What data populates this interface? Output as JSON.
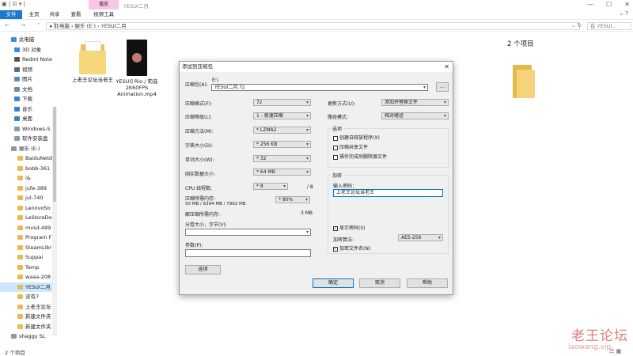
{
  "explorer": {
    "title": "YESUI二月",
    "quick_access": "▣ | ☑ ▾ |",
    "context_tab": "播放",
    "window_buttons": [
      "—",
      "☐",
      "✕"
    ],
    "ribbon_tabs": [
      "文件",
      "主页",
      "共享",
      "查看",
      "视频工具"
    ],
    "ribbon_right": "⌄ ?",
    "nav_buttons": "← → ⌃ ↑",
    "breadcrumb": "▸ 此电脑 › 娱乐 (E:) › YESUI二月",
    "breadcrumb_dropdown": "⌄ ↻",
    "search_placeholder": "在 YESUI...",
    "sidebar": [
      {
        "label": "此电脑",
        "icon": "computer-icon",
        "color": "#3a8fd8"
      },
      {
        "label": "3D 对象",
        "icon": "cube-icon",
        "color": "#3a8fd8"
      },
      {
        "label": "Redmi Note",
        "icon": "phone-icon",
        "color": "#555555"
      },
      {
        "label": "视频",
        "icon": "video-folder-icon",
        "color": "#5b6b7c"
      },
      {
        "label": "图片",
        "icon": "picture-folder-icon",
        "color": "#5b8bbd"
      },
      {
        "label": "文档",
        "icon": "document-folder-icon",
        "color": "#7a8896"
      },
      {
        "label": "下载",
        "icon": "download-folder-icon",
        "color": "#2f86d6"
      },
      {
        "label": "音乐",
        "icon": "music-folder-icon",
        "color": "#3b7fc8"
      },
      {
        "label": "桌面",
        "icon": "desktop-folder-icon",
        "color": "#3d82c7"
      },
      {
        "label": "Windows-S",
        "icon": "drive-icon",
        "color": "#8a9aa8"
      },
      {
        "label": "软件安装盘",
        "icon": "drive-icon",
        "color": "#8a9aa8"
      },
      {
        "label": "娱乐 (E:)",
        "icon": "drive-icon",
        "color": "#8a9aa8"
      },
      {
        "label": "BaiduNetd",
        "icon": "folder-icon",
        "color": "#e6bc4e"
      },
      {
        "label": "bobb-361",
        "icon": "folder-icon",
        "color": "#e6bc4e"
      },
      {
        "label": "i&",
        "icon": "folder-icon",
        "color": "#e6bc4e"
      },
      {
        "label": "jufe-389",
        "icon": "folder-icon",
        "color": "#e6bc4e"
      },
      {
        "label": "jul-740",
        "icon": "folder-icon",
        "color": "#e6bc4e"
      },
      {
        "label": "LenovoSo",
        "icon": "folder-icon",
        "color": "#e6bc4e"
      },
      {
        "label": "LeStoreDo",
        "icon": "folder-icon",
        "color": "#e6bc4e"
      },
      {
        "label": "mvsd-499",
        "icon": "folder-icon",
        "color": "#e6bc4e"
      },
      {
        "label": "Program F",
        "icon": "folder-icon",
        "color": "#e6bc4e"
      },
      {
        "label": "SteamLibr",
        "icon": "folder-icon",
        "color": "#e6bc4e"
      },
      {
        "label": "Suppai",
        "icon": "folder-icon",
        "color": "#e6bc4e"
      },
      {
        "label": "Temp",
        "icon": "folder-icon",
        "color": "#e6bc4e"
      },
      {
        "label": "waaa-208",
        "icon": "folder-icon",
        "color": "#e6bc4e"
      },
      {
        "label": "YESUI二月",
        "icon": "folder-icon",
        "color": "#e6bc4e",
        "selected": true
      },
      {
        "label": "没有7",
        "icon": "folder-icon",
        "color": "#e6bc4e"
      },
      {
        "label": "上老王论坛",
        "icon": "folder-icon",
        "color": "#e6bc4e"
      },
      {
        "label": "新建文件夹",
        "icon": "folder-icon",
        "color": "#e6bc4e"
      },
      {
        "label": "新建文件夹",
        "icon": "folder-icon",
        "color": "#e6bc4e"
      },
      {
        "label": "shaggy SL",
        "icon": "drive-icon",
        "color": "#8a9aa8"
      }
    ],
    "files": [
      {
        "name": "上老王论坛当老王",
        "type": "folder"
      },
      {
        "name": "YESUI] Rio / 莉音 2K60FPS Animation.mp4",
        "type": "video"
      }
    ],
    "item_count_right": "2 个项目",
    "status": "2 个项目",
    "view_buttons": "☷ ▦",
    "watermark": "老王论坛",
    "watermark_sub": "laowang.vip"
  },
  "dialog": {
    "title": "添加到压缩包",
    "close": "✕",
    "archive_label": "压缩包(A):",
    "archive_path": "E:\\",
    "archive_value": "YESUI二月.7z",
    "browse_button": "...",
    "left_fields": [
      {
        "label": "压缩格式(F):",
        "value": "7z"
      },
      {
        "label": "压缩等级(L):",
        "value": "1 - 极速压缩"
      },
      {
        "label": "压缩方法(M):",
        "value": "* LZMA2"
      },
      {
        "label": "字典大小(D):",
        "value": "* 256 KB"
      },
      {
        "label": "单词大小(W):",
        "value": "* 32"
      },
      {
        "label": "固实数据大小:",
        "value": "* 64 MB"
      }
    ],
    "cpu_label": "CPU 线程数:",
    "cpu_value": "* 8",
    "cpu_max": "/ 8",
    "mem_label": "压缩所需内存:",
    "mem_detail": "50 MB / 6394 MB / 7992 MB",
    "mem_value": "* 80%",
    "decomp_label": "解压缩所需内存:",
    "decomp_value": "3 MB",
    "split_label": "分卷大小，字节(V):",
    "params_label": "参数(P):",
    "options_button": "选项",
    "update_label": "更新方式(U):",
    "update_value": "添加并替换文件",
    "pathmode_label": "路径模式:",
    "pathmode_value": "相对路径",
    "options_group": "选项",
    "options": [
      {
        "label": "创建自释放程序(X)",
        "checked": false
      },
      {
        "label": "压缩共享文件",
        "checked": false
      },
      {
        "label": "操作完成后删除源文件",
        "checked": false
      }
    ],
    "encrypt_group": "加密",
    "password_label": "输入密码：",
    "password_value": "上老王论坛当老王",
    "show_password": {
      "label": "显示密码(S)",
      "checked": true
    },
    "encrypt_method_label": "加密算法:",
    "encrypt_method_value": "AES-256",
    "encrypt_names": {
      "label": "加密文件名(N)",
      "checked": true
    },
    "ok_button": "确定",
    "cancel_button": "取消",
    "help_button": "帮助"
  }
}
